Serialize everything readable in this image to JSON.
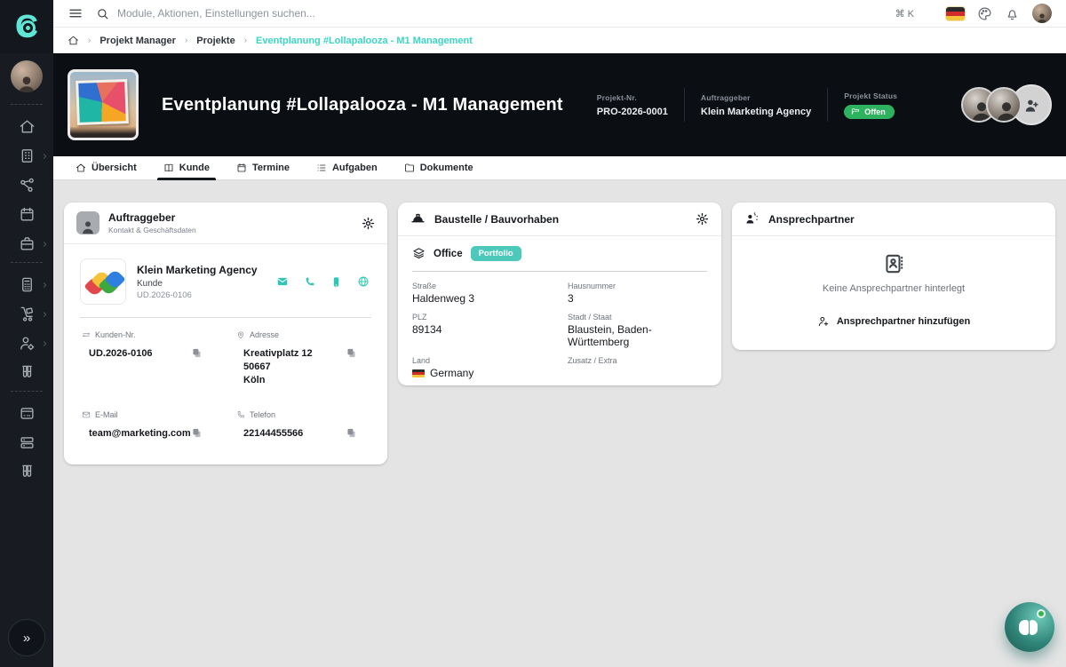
{
  "topbar": {
    "search_placeholder": "Module, Aktionen, Einstellungen suchen...",
    "shortcut": "⌘ K",
    "icons": [
      "hamburger-icon",
      "search-icon",
      "german-flag",
      "palette-icon",
      "bell-icon",
      "user-avatar"
    ]
  },
  "breadcrumb": {
    "item1": "Projekt Manager",
    "item2": "Projekte",
    "current": "Eventplanung #Lollapalooza - M1 Management"
  },
  "header": {
    "title": "Eventplanung #Lollapalooza - M1 Management",
    "project_nr_label": "Projekt-Nr.",
    "project_nr": "PRO-2026-0001",
    "client_label": "Auftraggeber",
    "client": "Klein Marketing Agency",
    "status_label": "Projekt Status",
    "status": "Offen",
    "status_color": "#2fb25f"
  },
  "tabs": [
    {
      "label": "Übersicht",
      "icon": "home-icon",
      "active": false
    },
    {
      "label": "Kunde",
      "icon": "contact-book-icon",
      "active": true
    },
    {
      "label": "Termine",
      "icon": "calendar-icon",
      "active": false
    },
    {
      "label": "Aufgaben",
      "icon": "list-icon",
      "active": false
    },
    {
      "label": "Dokumente",
      "icon": "folder-icon",
      "active": false
    }
  ],
  "sidebar": {
    "icons": [
      "home-icon",
      "building-icon",
      "network-icon",
      "calendar-icon",
      "briefcase-icon",
      "calculator-icon",
      "handtruck-icon",
      "person-gear-icon",
      "tubes-icon",
      "terminal-icon",
      "rack-icon",
      "tubes-icon-2"
    ],
    "collapse": "»"
  },
  "cards": {
    "client": {
      "title": "Auftraggeber",
      "subtitle": "Kontakt & Geschäftsdaten",
      "company": "Klein Marketing Agency",
      "company_type": "Kunde",
      "company_id": "UD.2026-0106",
      "action_icons": [
        "mail-icon",
        "phone-icon",
        "smartphone-icon",
        "globe-icon"
      ],
      "customer_nr_label": "Kunden-Nr.",
      "customer_nr": "UD.2026-0106",
      "address_label": "Adresse",
      "address_line1": "Kreativplatz 12",
      "address_line2": "50667",
      "address_line3": "Köln",
      "email_label": "E-Mail",
      "email": "team@marketing.com",
      "phone_label": "Telefon",
      "phone": "22144455566"
    },
    "site": {
      "title": "Baustelle / Bauvorhaben",
      "name": "Office",
      "badge": "Portfolio",
      "badge_color": "#4cc9ba",
      "street_label": "Straße",
      "street": "Haldenweg 3",
      "number_label": "Hausnummer",
      "number": "3",
      "plz_label": "PLZ",
      "plz": "89134",
      "city_label": "Stadt / Staat",
      "city": "Blaustein, Baden-Württemberg",
      "country_label": "Land",
      "country": "Germany",
      "extra_label": "Zusatz / Extra",
      "extra": ""
    },
    "contacts": {
      "title": "Ansprechpartner",
      "empty_text": "Keine Ansprechpartner hinterlegt",
      "add_label": "Ansprechpartner hinzufügen"
    }
  },
  "colors": {
    "accent_teal": "#3ad6c3",
    "sidebar_bg": "#181c22",
    "header_bg": "#0b0e12",
    "content_bg": "#e4e4e4"
  }
}
